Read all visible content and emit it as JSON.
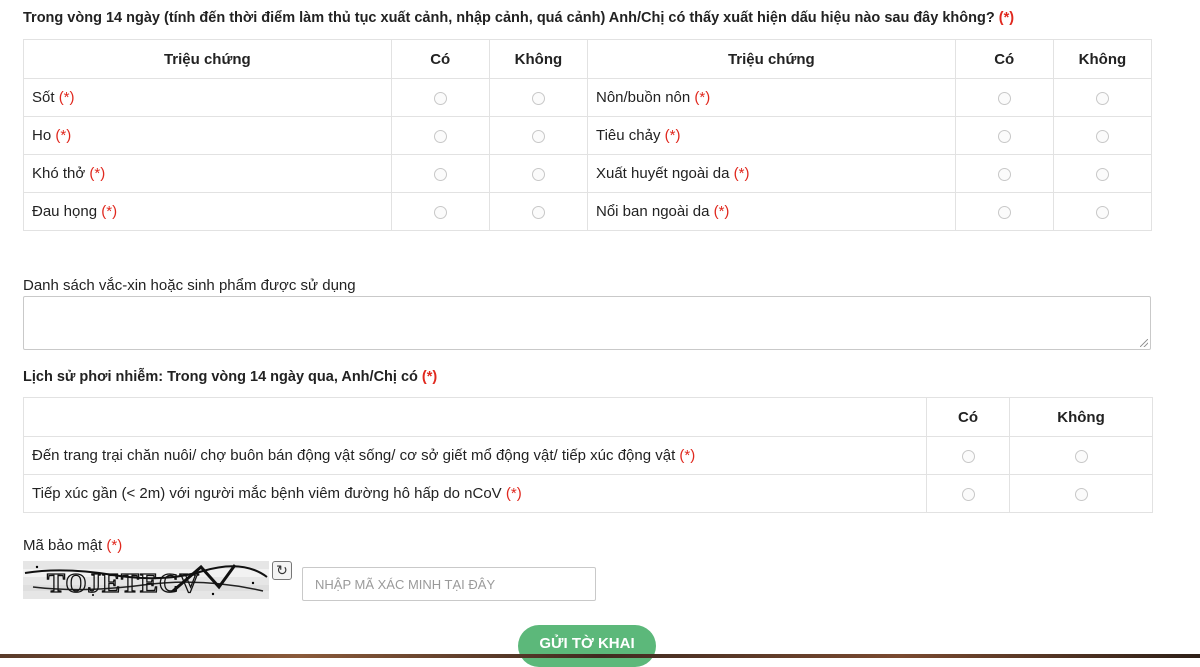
{
  "symptoms": {
    "question": "Trong vòng 14 ngày (tính đến thời điểm làm thủ tục xuất cảnh, nhập cảnh, quá cảnh) Anh/Chị có thấy xuất hiện dấu hiệu nào sau đây không?",
    "required_mark": "(*)",
    "headers": {
      "symptom": "Triệu chứng",
      "yes": "Có",
      "no": "Không"
    },
    "left": [
      {
        "label": "Sốt",
        "req": "(*)"
      },
      {
        "label": "Ho",
        "req": "(*)"
      },
      {
        "label": "Khó thở",
        "req": "(*)"
      },
      {
        "label": "Đau họng",
        "req": "(*)"
      }
    ],
    "right": [
      {
        "label": "Nôn/buồn nôn",
        "req": "(*)"
      },
      {
        "label": "Tiêu chảy",
        "req": "(*)"
      },
      {
        "label": "Xuất huyết ngoài da",
        "req": "(*)"
      },
      {
        "label": "Nổi ban ngoài da",
        "req": "(*)"
      }
    ]
  },
  "vaccine": {
    "label": "Danh sách vắc-xin hoặc sinh phẩm được sử dụng",
    "value": ""
  },
  "exposure": {
    "title": "Lịch sử phơi nhiễm: Trong vòng 14 ngày qua, Anh/Chị có",
    "required_mark": "(*)",
    "headers": {
      "yes": "Có",
      "no": "Không"
    },
    "rows": [
      {
        "label": "Đến trang trại chăn nuôi/ chợ buôn bán động vật sống/ cơ sở giết mổ động vật/ tiếp xúc động vật",
        "req": "(*)"
      },
      {
        "label": "Tiếp xúc gần (< 2m) với người mắc bệnh viêm đường hô hấp do nCoV",
        "req": "(*)"
      }
    ]
  },
  "captcha": {
    "label": "Mã bảo mật",
    "required_mark": "(*)",
    "image_text": "TOJETECV",
    "refresh_icon": "refresh-icon",
    "input_placeholder": "NHẬP MÃ XÁC MINH TẠI ĐÂY",
    "input_value": ""
  },
  "submit": {
    "label": "GỬI TỜ KHAI",
    "color": "#5cb87a"
  },
  "colors": {
    "required": "#e0281e",
    "border": "#e2e2e2"
  }
}
